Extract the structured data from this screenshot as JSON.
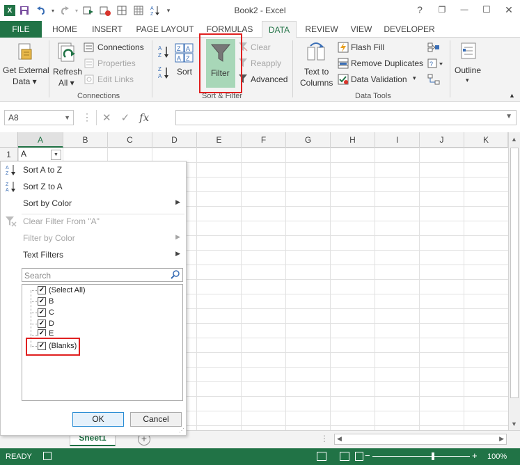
{
  "app": {
    "title": "Book2 - Excel",
    "icon": "X"
  },
  "qat": {
    "icons": [
      "save-icon",
      "undo-icon",
      "redo-icon",
      "macro-icon",
      "stop-icon",
      "table-icon",
      "grid-icon",
      "sort-icon"
    ]
  },
  "window": {
    "help": "?",
    "restore": "❐",
    "minimize": "—",
    "maximize": "☐",
    "close": "✕"
  },
  "tabs": [
    "FILE",
    "HOME",
    "INSERT",
    "PAGE LAYOUT",
    "FORMULAS",
    "DATA",
    "REVIEW",
    "VIEW",
    "DEVELOPER"
  ],
  "ribbon": {
    "get_external_data": "Get External",
    "get_external_data2": "Data ▾",
    "refresh_all": "Refresh",
    "refresh_all2": "All ▾",
    "connections": "Connections",
    "properties": "Properties",
    "edit_links": "Edit Links",
    "group_connections": "Connections",
    "sort_az": "A→Z",
    "sort_za": "Z→A",
    "sort": "Sort",
    "filter": "Filter",
    "clear": "Clear",
    "reapply": "Reapply",
    "advanced": "Advanced",
    "group_sort_filter": "Sort & Filter",
    "text_to_columns": "Text to",
    "text_to_columns2": "Columns",
    "flash_fill": "Flash Fill",
    "remove_duplicates": "Remove Duplicates",
    "data_validation": "Data Validation",
    "group_data_tools": "Data Tools",
    "outline": "Outline"
  },
  "formula_bar": {
    "name_box": "A8",
    "cancel": "✕",
    "enter": "✓",
    "fx": "fx",
    "value": ""
  },
  "grid": {
    "columns": [
      "A",
      "B",
      "C",
      "D",
      "E",
      "F",
      "G",
      "H",
      "I",
      "J",
      "K"
    ],
    "rows": [
      "1"
    ],
    "cell_a1": "A"
  },
  "filter_menu": {
    "sort_a_z": "Sort A to Z",
    "sort_z_a": "Sort Z to A",
    "sort_by_color": "Sort by Color",
    "clear_filter": "Clear Filter From \"A\"",
    "filter_by_color": "Filter by Color",
    "text_filters": "Text Filters",
    "search_placeholder": "Search",
    "items": [
      {
        "label": "(Select All)",
        "checked": true
      },
      {
        "label": "B",
        "checked": true
      },
      {
        "label": "C",
        "checked": true
      },
      {
        "label": "D",
        "checked": true
      },
      {
        "label": "E",
        "checked": true
      },
      {
        "label": "(Blanks)",
        "checked": true
      }
    ],
    "ok": "OK",
    "cancel": "Cancel"
  },
  "sheet": {
    "tab": "Sheet1",
    "add": "+"
  },
  "status": {
    "ready": "READY",
    "zoom": "100%",
    "zoom_minus": "−",
    "zoom_plus": "+"
  },
  "colors": {
    "accent": "#217346",
    "highlight": "#e02020",
    "filter_active": "#a8d7b8"
  }
}
